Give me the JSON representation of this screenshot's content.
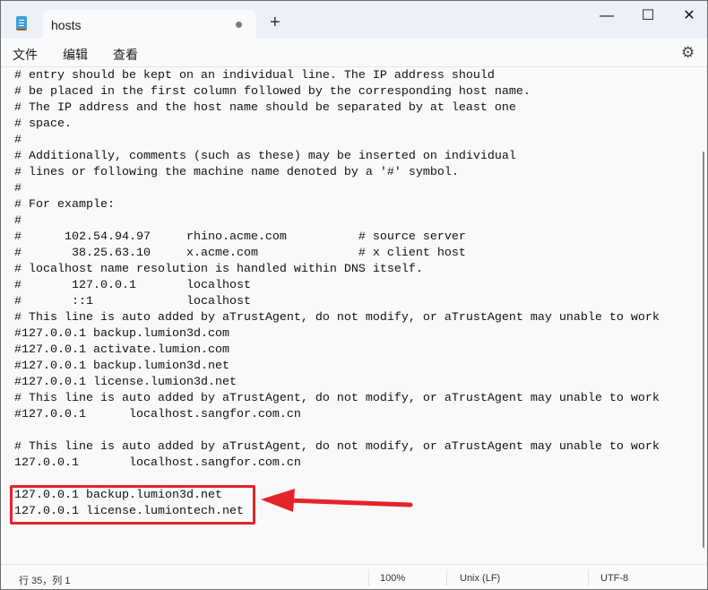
{
  "titlebar": {
    "tab_title": "hosts",
    "new_tab": "+",
    "minimize": "—",
    "maximize": "☐",
    "close": "✕"
  },
  "menu": {
    "file": "文件",
    "edit": "编辑",
    "view": "查看",
    "settings_icon": "⚙"
  },
  "editor": {
    "lines": [
      "# entry should be kept on an individual line. The IP address should",
      "# be placed in the first column followed by the corresponding host name.",
      "# The IP address and the host name should be separated by at least one",
      "# space.",
      "#",
      "# Additionally, comments (such as these) may be inserted on individual",
      "# lines or following the machine name denoted by a '#' symbol.",
      "#",
      "# For example:",
      "#",
      "#      102.54.94.97     rhino.acme.com          # source server",
      "#       38.25.63.10     x.acme.com              # x client host",
      "# localhost name resolution is handled within DNS itself.",
      "#       127.0.0.1       localhost",
      "#       ::1             localhost",
      "# This line is auto added by aTrustAgent, do not modify, or aTrustAgent may unable to work",
      "#127.0.0.1 backup.lumion3d.com",
      "#127.0.0.1 activate.lumion.com",
      "#127.0.0.1 backup.lumion3d.net",
      "#127.0.0.1 license.lumion3d.net",
      "# This line is auto added by aTrustAgent, do not modify, or aTrustAgent may unable to work",
      "#127.0.0.1      localhost.sangfor.com.cn",
      "",
      "# This line is auto added by aTrustAgent, do not modify, or aTrustAgent may unable to work",
      "127.0.0.1       localhost.sangfor.com.cn",
      "",
      "127.0.0.1 backup.lumion3d.net",
      "127.0.0.1 license.lumiontech.net"
    ]
  },
  "annotation": {
    "color": "#e5232b"
  },
  "status": {
    "position": "行 35，列 1",
    "zoom": "100%",
    "line_ending": "Unix (LF)",
    "encoding": "UTF-8"
  }
}
